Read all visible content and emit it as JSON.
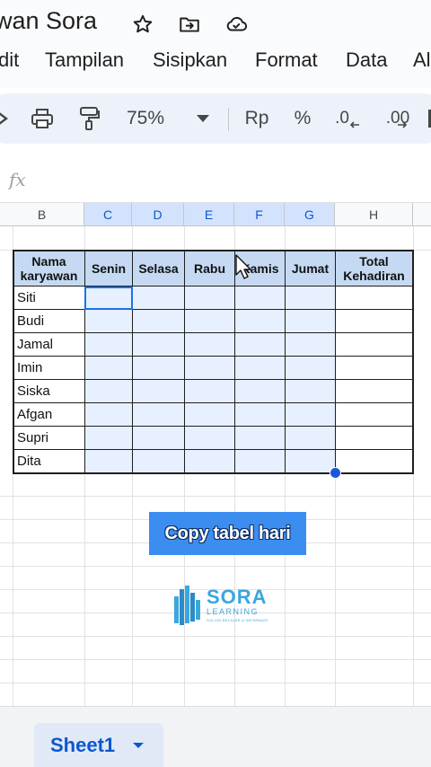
{
  "window": {
    "doc_title": "wan Sora",
    "icons": [
      "star-icon",
      "move-to-folder-icon",
      "cloud-saved-icon"
    ]
  },
  "menu": {
    "items": [
      "dit",
      "Tampilan",
      "Sisipkan",
      "Format",
      "Data",
      "Al"
    ]
  },
  "toolbar": {
    "zoom": "75%",
    "currency": "Rp",
    "percent": "%",
    "decrease_decimal": ".0",
    "increase_decimal": ".00",
    "icons": [
      "print-icon",
      "paint-format-icon",
      "dropdown-caret-icon"
    ]
  },
  "formula_bar": {
    "fx_label": "fx",
    "value": ""
  },
  "grid": {
    "columns": [
      "B",
      "C",
      "D",
      "E",
      "F",
      "G",
      "H"
    ],
    "selected_columns": [
      "C",
      "D",
      "E",
      "F",
      "G"
    ]
  },
  "table": {
    "headers": [
      "Nama karyawan",
      "Senin",
      "Selasa",
      "Rabu",
      "Kamis",
      "Jumat",
      "Total Kehadiran"
    ],
    "names": [
      "Siti",
      "Budi",
      "Jamal",
      "Imin",
      "Siska",
      "Afgan",
      "Supri",
      "Dita"
    ]
  },
  "overlay": {
    "caption": "Copy tabel hari",
    "logo_name": "SORA",
    "logo_sub": "LEARNING",
    "logo_tagline": "SOLUSI BELAJAR & INFORMASI"
  },
  "sheets": {
    "active": "Sheet1"
  },
  "colors": {
    "selection": "#d3e3fd",
    "accent": "#1a73e8",
    "caption_bg": "#3b8df0"
  }
}
